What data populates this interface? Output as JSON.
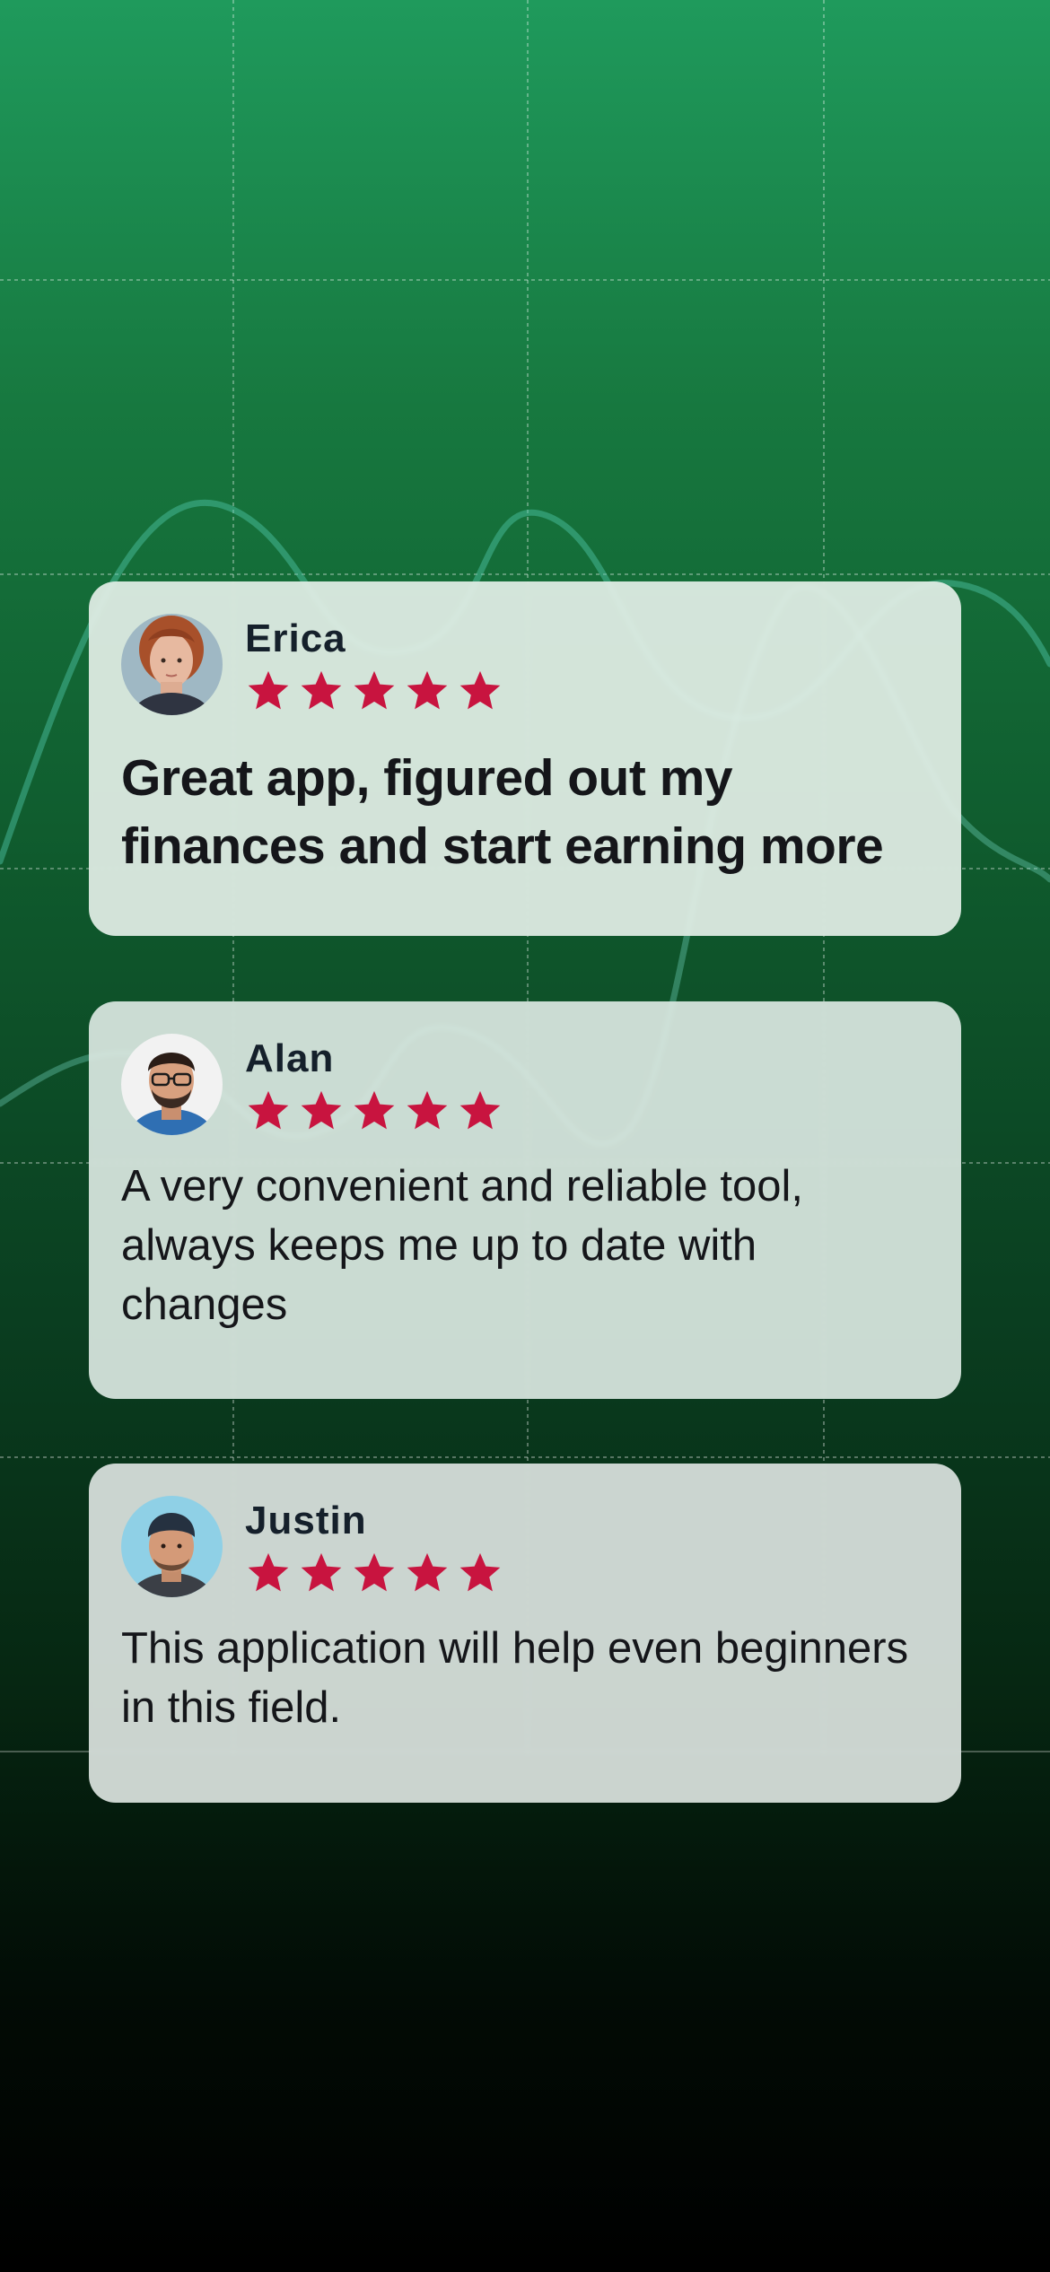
{
  "colors": {
    "star": "#c8143f",
    "card_text": "#15161a",
    "name_text": "#15202b",
    "background_top": "#1f9a5c",
    "background_bottom": "#000000"
  },
  "reviews": [
    {
      "name": "Erica",
      "rating": 5,
      "text": "Great app, figured out my finances and start earning more",
      "text_style": "bold",
      "avatar_icon": "woman-portrait-avatar"
    },
    {
      "name": "Alan",
      "rating": 5,
      "text": "A very convenient and reliable tool, always keeps me up to date with changes",
      "text_style": "regular",
      "avatar_icon": "man-glasses-portrait-avatar"
    },
    {
      "name": "Justin",
      "rating": 5,
      "text": "This application will help even beginners in this field.",
      "text_style": "regular",
      "avatar_icon": "man-beanie-portrait-avatar"
    }
  ]
}
